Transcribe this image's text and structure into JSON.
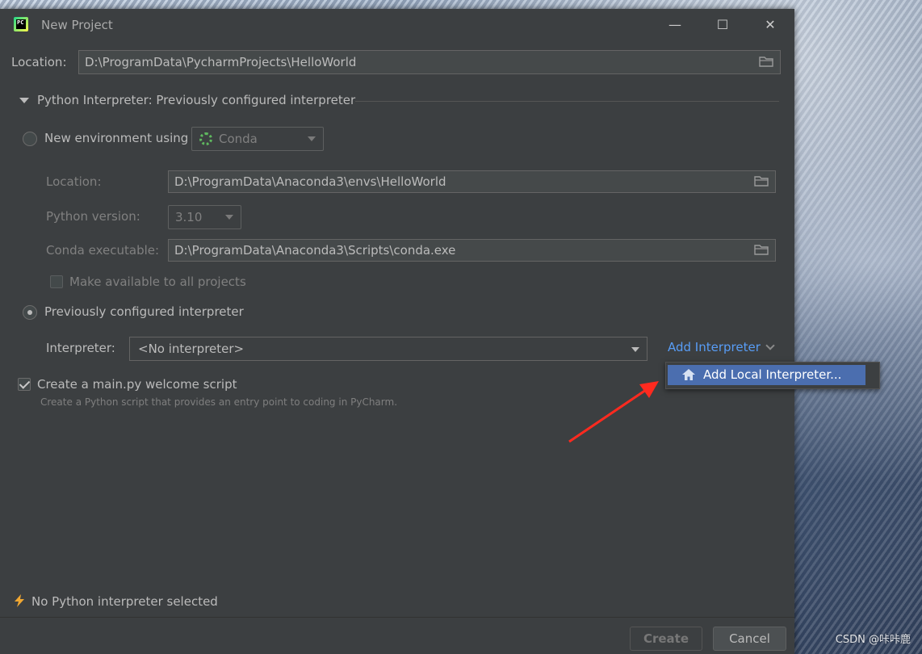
{
  "window": {
    "title": "New Project",
    "controls": {
      "minimize": "—",
      "maximize": "☐",
      "close": "✕"
    }
  },
  "project": {
    "location_label": "Location:",
    "location_value": "D:\\ProgramData\\PycharmProjects\\HelloWorld"
  },
  "interpreter_section": {
    "title": "Python Interpreter: Previously configured interpreter",
    "new_env": {
      "radio_label": "New environment using",
      "tool": "Conda",
      "location_label": "Location:",
      "location_value": "D:\\ProgramData\\Anaconda3\\envs\\HelloWorld",
      "python_version_label": "Python version:",
      "python_version_value": "3.10",
      "conda_exec_label": "Conda executable:",
      "conda_exec_value": "D:\\ProgramData\\Anaconda3\\Scripts\\conda.exe",
      "make_available_label": "Make available to all projects"
    },
    "previous": {
      "radio_label": "Previously configured interpreter",
      "interpreter_label": "Interpreter:",
      "interpreter_value": "<No interpreter>",
      "add_interpreter_label": "Add Interpreter"
    },
    "popup": {
      "items": [
        {
          "label": "Add Local Interpreter..."
        }
      ]
    }
  },
  "welcome_script": {
    "label": "Create a main.py welcome script",
    "hint": "Create a Python script that provides an entry point to coding in PyCharm."
  },
  "status": {
    "message": "No Python interpreter selected"
  },
  "buttons": {
    "create": "Create",
    "cancel": "Cancel"
  },
  "watermark": "CSDN @咔咔鹿",
  "colors": {
    "dialog_bg": "#3c3f41",
    "link": "#589df6",
    "selection": "#4b6eaf",
    "annotation_arrow": "#ff2a1f",
    "warning_bolt": "#f0a732"
  }
}
